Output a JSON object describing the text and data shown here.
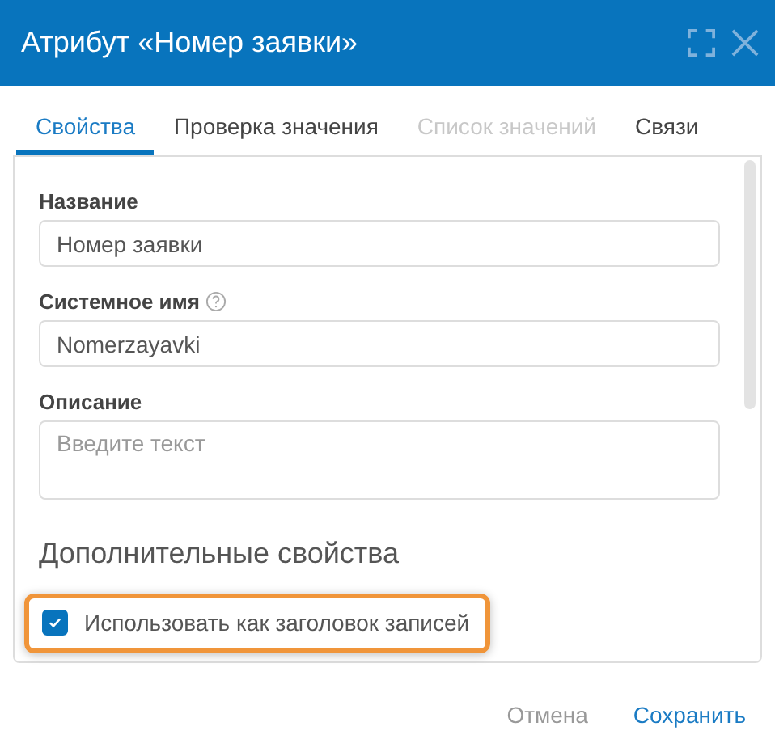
{
  "window": {
    "title": "Атрибут «Номер заявки»"
  },
  "tabs": [
    {
      "label": "Свойства",
      "selected": true,
      "disabled": false
    },
    {
      "label": "Проверка значения",
      "selected": false,
      "disabled": false
    },
    {
      "label": "Список значений",
      "selected": false,
      "disabled": true
    },
    {
      "label": "Связи",
      "selected": false,
      "disabled": false
    }
  ],
  "fields": [
    {
      "kind": "input",
      "label": "Название",
      "value": "Номер заявки",
      "help": false
    },
    {
      "kind": "input",
      "label": "Системное имя",
      "value": "Nomerzayavki",
      "help": true
    },
    {
      "kind": "textarea",
      "label": "Описание",
      "placeholder": "Введите текст",
      "help": false
    }
  ],
  "section": {
    "title": "Дополнительные свойства"
  },
  "options": [
    {
      "label": "Использовать как заголовок записей",
      "checked": true,
      "highlighted": true
    }
  ],
  "buttons": [
    {
      "label": "Отмена",
      "kind": "secondary"
    },
    {
      "label": "Сохранить",
      "kind": "primary"
    }
  ]
}
